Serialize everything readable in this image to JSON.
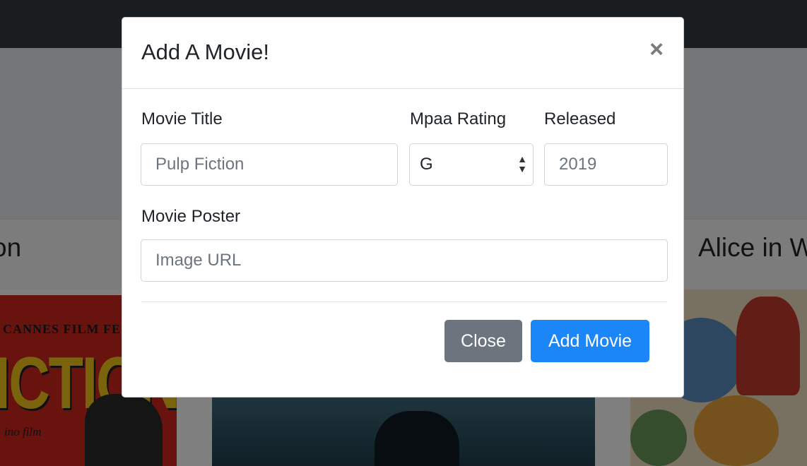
{
  "background": {
    "left_card_title": "ction",
    "right_card_title": "Alice in W",
    "poster_left": {
      "festival": "CANNES FILM FESTIVA",
      "headline": "ICTION",
      "tagline": "ino film"
    }
  },
  "modal": {
    "title": "Add A Movie!",
    "close_icon": "×",
    "fields": {
      "title_label": "Movie Title",
      "title_placeholder": "Pulp Fiction",
      "rating_label": "Mpaa Rating",
      "rating_value": "G",
      "released_label": "Released",
      "released_placeholder": "2019",
      "poster_label": "Movie Poster",
      "poster_placeholder": "Image URL"
    },
    "buttons": {
      "close": "Close",
      "add": "Add Movie"
    }
  },
  "colors": {
    "primary": "#1a86f7",
    "secondary": "#6c757d",
    "navbar": "#343a40"
  }
}
